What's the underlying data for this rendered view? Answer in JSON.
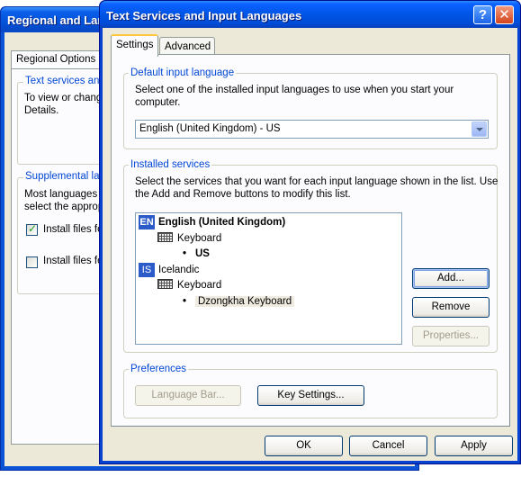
{
  "background_window": {
    "title": "Regional and Language Options",
    "tab_label": "Regional Options",
    "text_services_legend": "Text services and input languages",
    "text_services_desc_line1": "To view or change the languages and methods you can use to enter text, click",
    "text_services_desc_line2": "Details.",
    "supplemental_legend": "Supplemental language support",
    "supplemental_desc_line1": "Most languages are installed by default. To install additional languages,",
    "supplemental_desc_line2": "select the appropriate check box below.",
    "checkbox1_label": "Install files for complex script and right-to-left languages",
    "checkbox1_checked": true,
    "checkbox2_label": "Install files for East Asian languages",
    "checkbox2_checked": false
  },
  "dialog": {
    "title": "Text Services and Input Languages",
    "help_glyph": "?",
    "close_glyph": "✕",
    "tabs": [
      {
        "label": "Settings",
        "active": true
      },
      {
        "label": "Advanced",
        "active": false
      }
    ],
    "default_input": {
      "legend": "Default input language",
      "description": "Select one of the installed input languages to use when you start your computer.",
      "selected_value": "English (United Kingdom) - US"
    },
    "installed_services": {
      "legend": "Installed services",
      "description": "Select the services that you want for each input language shown in the list. Use the Add and Remove buttons to modify this list.",
      "tree": [
        {
          "badge": "EN",
          "label": "English (United Kingdom)",
          "bold": true
        },
        {
          "type": "group",
          "label": "Keyboard"
        },
        {
          "type": "item",
          "bullet": "•",
          "label": "US",
          "bold": true
        },
        {
          "badge": "IS",
          "label": "Icelandic"
        },
        {
          "type": "group",
          "label": "Keyboard"
        },
        {
          "type": "item",
          "bullet": "•",
          "label": "Dzongkha Keyboard",
          "selected": true
        }
      ],
      "buttons": {
        "add": "Add...",
        "remove": "Remove",
        "properties": "Properties..."
      }
    },
    "preferences": {
      "legend": "Preferences",
      "language_bar": "Language Bar...",
      "key_settings": "Key Settings..."
    },
    "footer": {
      "ok": "OK",
      "cancel": "Cancel",
      "apply": "Apply"
    }
  },
  "colors": {
    "xp_blue_title": "#0055e5",
    "legend_blue": "#0046d5",
    "dialog_face": "#ece9d8"
  }
}
